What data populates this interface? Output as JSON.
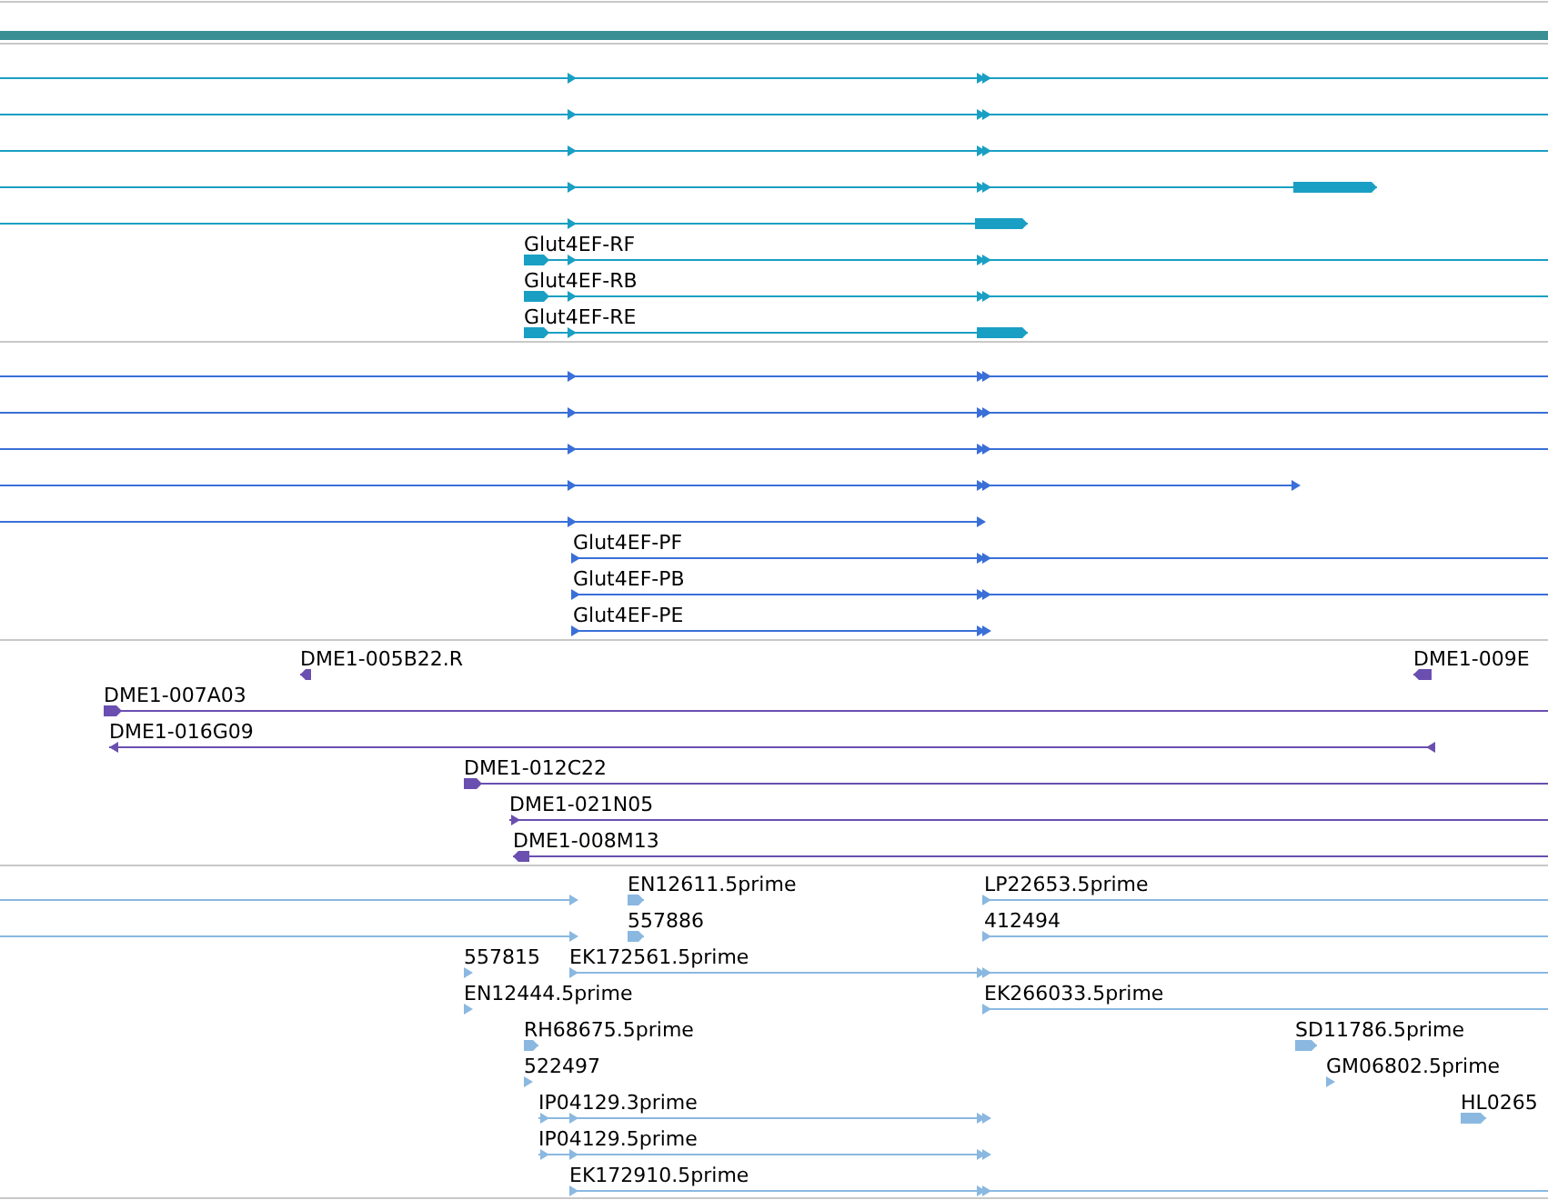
{
  "tracks": [
    {
      "kind": "transcript",
      "labels": [
        "Glut4EF-RF",
        "Glut4EF-RB",
        "Glut4EF-RE"
      ]
    },
    {
      "kind": "protein",
      "labels": [
        "Glut4EF-PF",
        "Glut4EF-PB",
        "Glut4EF-PE"
      ]
    },
    {
      "kind": "clone",
      "labels": [
        "DME1-005B22.R",
        "DME1-009E",
        "DME1-007A03",
        "DME1-016G09",
        "DME1-012C22",
        "DME1-021N05",
        "DME1-008M13"
      ]
    },
    {
      "kind": "est",
      "labels": [
        "EN12611.5prime",
        "LP22653.5prime",
        "557886",
        "412494",
        "557815",
        "EK172561.5prime",
        "EN12444.5prime",
        "EK266033.5prime",
        "RH68675.5prime",
        "SD11786.5prime",
        "522497",
        "GM06802.5prime",
        "IP04129.3prime",
        "HL0265",
        "IP04129.5prime",
        "EK172910.5prime"
      ]
    }
  ]
}
